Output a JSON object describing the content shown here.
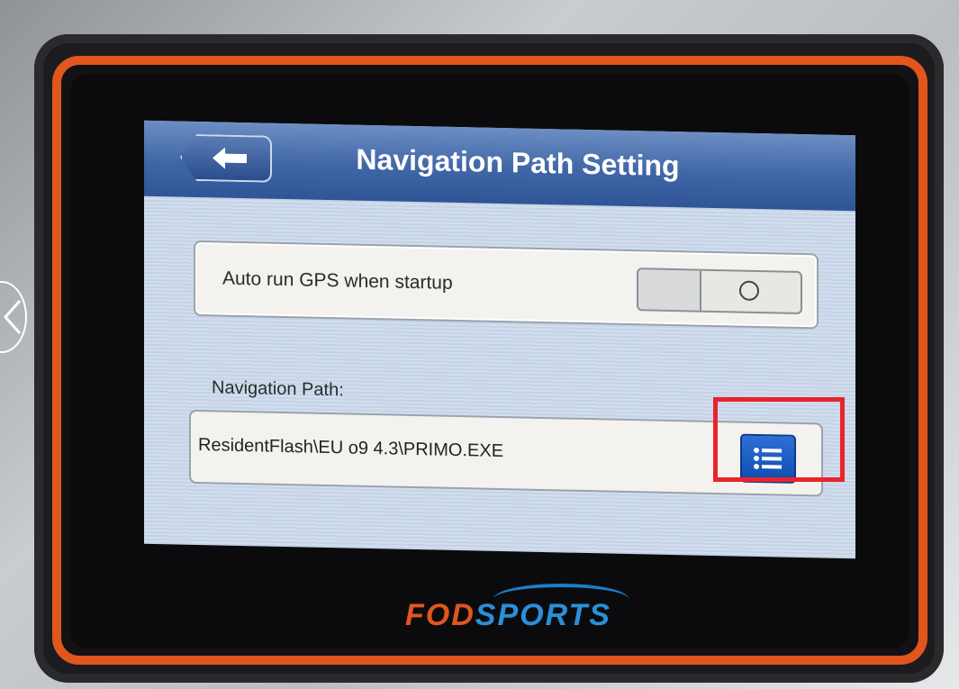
{
  "header": {
    "title": "Navigation Path Setting",
    "back_icon": "arrow-left-icon"
  },
  "settings": {
    "auto_run_label": "Auto run GPS when startup",
    "auto_run_toggle_state": "off",
    "navigation_path_label": "Navigation Path:",
    "navigation_path_value": "ResidentFlash\\EU o9 4.3\\PRIMO.EXE",
    "browse_icon": "list-icon"
  },
  "device": {
    "brand_part1": "FOD",
    "brand_part2": "SPORTS",
    "accent_color": "#e0561d",
    "brand_blue": "#2a8fd8"
  },
  "overlay": {
    "highlight_color": "#e8232b",
    "prev_icon": "chevron-left-icon"
  }
}
